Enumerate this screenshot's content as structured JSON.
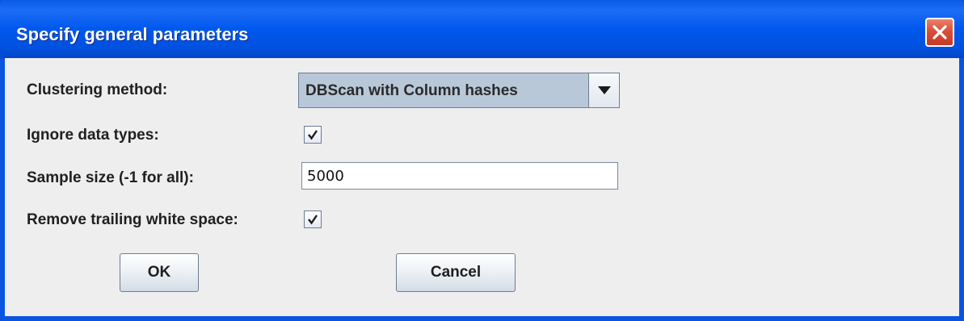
{
  "window": {
    "title": "Specify general parameters",
    "close_icon": "close-icon",
    "title_color": "#0058ee",
    "close_color": "#d9503a"
  },
  "form": {
    "clustering_method": {
      "label": "Clustering method:",
      "value": "DBScan with Column hashes",
      "icon": "chevron-down-icon"
    },
    "ignore_data_types": {
      "label": "Ignore data types:",
      "checked": true
    },
    "sample_size": {
      "label": "Sample size (-1 for all):",
      "value": "5000"
    },
    "remove_trailing_white_space": {
      "label": "Remove trailing white space:",
      "checked": true
    }
  },
  "buttons": {
    "ok_label": "OK",
    "cancel_label": "Cancel"
  }
}
